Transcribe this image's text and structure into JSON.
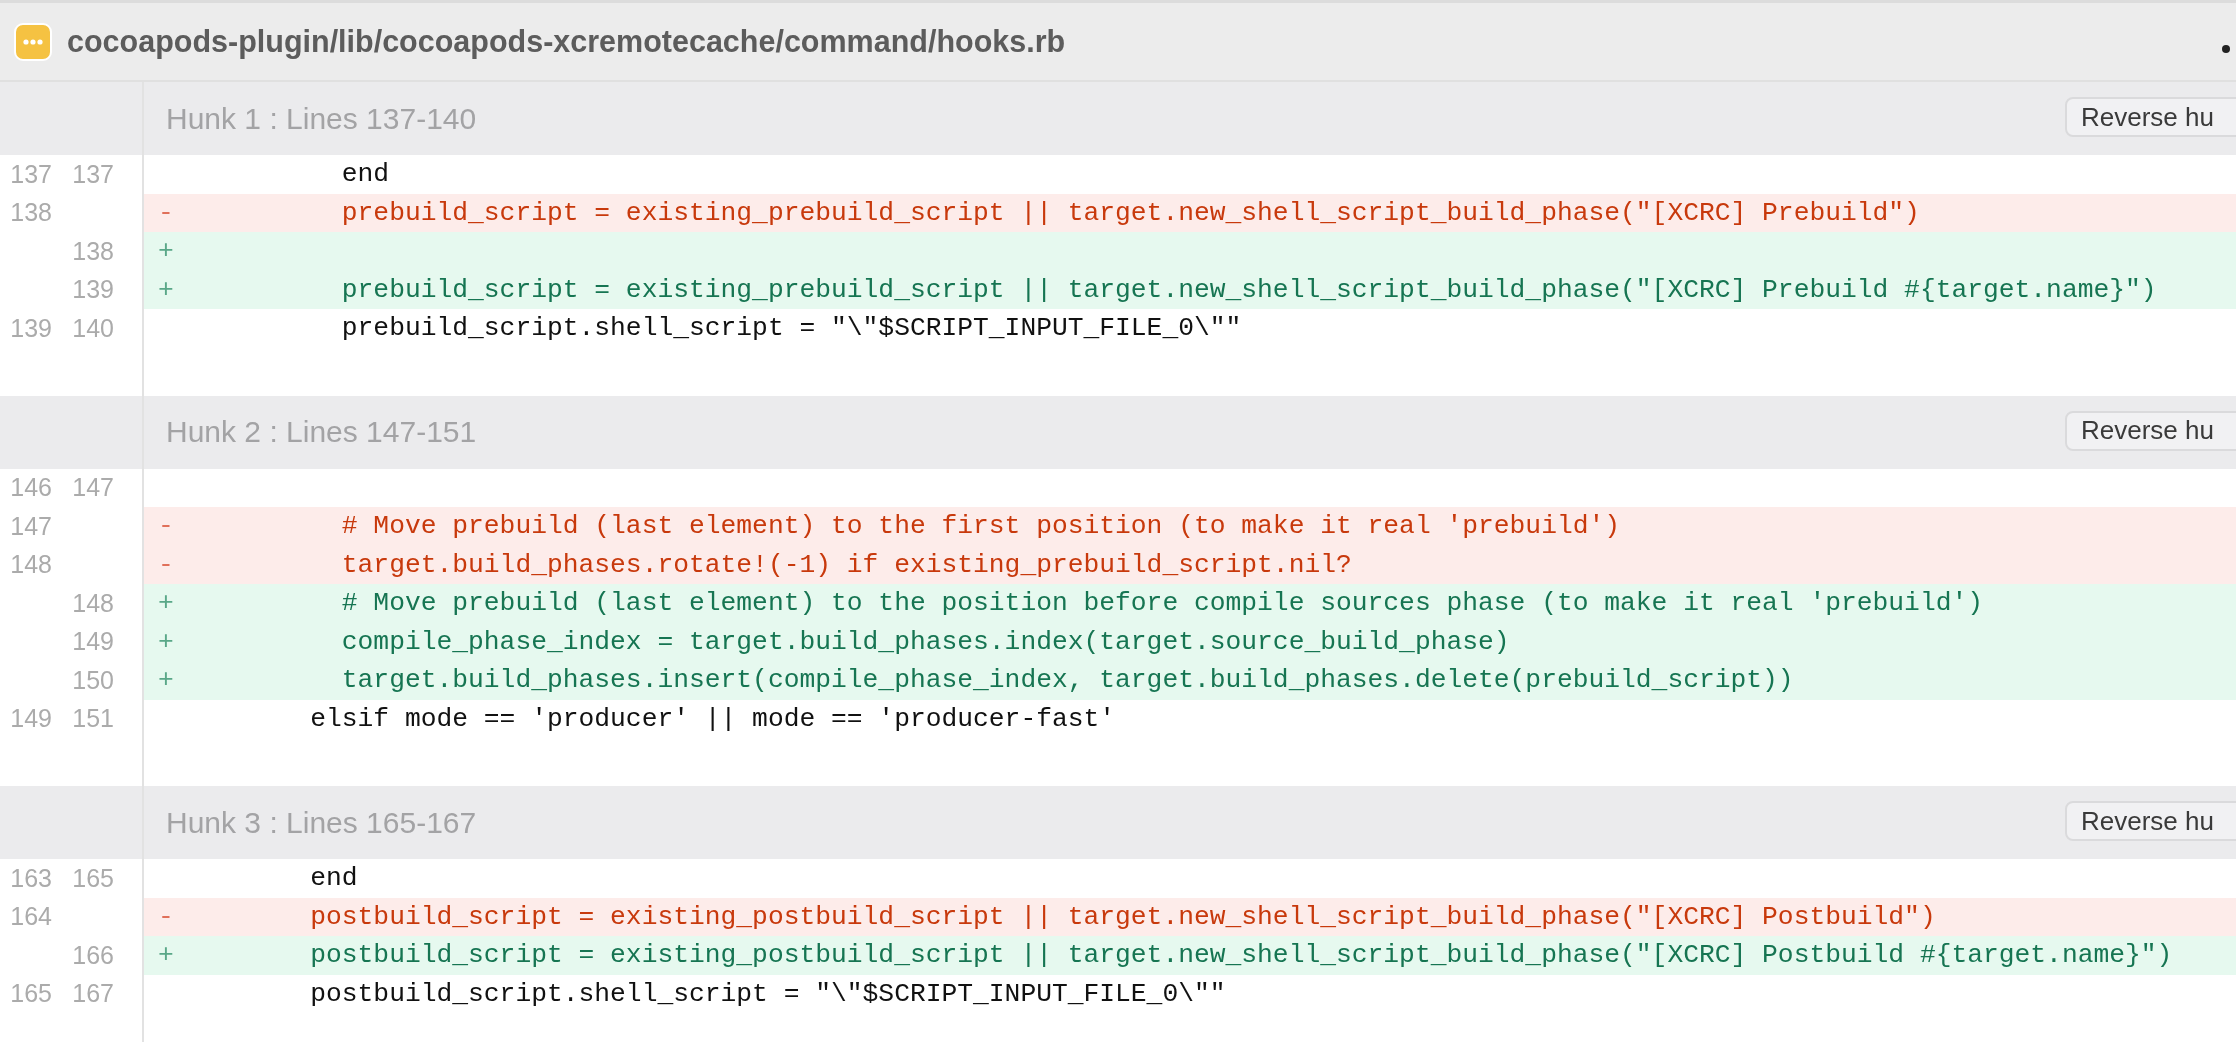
{
  "file_header": {
    "path": "cocoapods-plugin/lib/cocoapods-xcremotecache/command/hooks.rb"
  },
  "hunks": [
    {
      "title": "Hunk 1 : Lines 137-140",
      "button": "Reverse hu",
      "lines": [
        {
          "kind": "context",
          "old": "137",
          "new": "137",
          "text": "          end"
        },
        {
          "kind": "removed",
          "old": "138",
          "sign": "-",
          "text": "          prebuild_script = existing_prebuild_script || target.new_shell_script_build_phase(\"[XCRC] Prebuild\")"
        },
        {
          "kind": "added",
          "new": "138",
          "sign": "+"
        },
        {
          "kind": "added",
          "new": "139",
          "sign": "+",
          "text": "          prebuild_script = existing_prebuild_script || target.new_shell_script_build_phase(\"[XCRC] Prebuild #{target.name}\")"
        },
        {
          "kind": "context",
          "old": "139",
          "new": "140",
          "text": "          prebuild_script.shell_script = \"\\\"$SCRIPT_INPUT_FILE_0\\\"\""
        }
      ]
    },
    {
      "title": "Hunk 2 : Lines 147-151",
      "button": "Reverse hu",
      "lines": [
        {
          "kind": "context",
          "old": "146",
          "new": "147"
        },
        {
          "kind": "removed",
          "old": "147",
          "sign": "-",
          "text": "          # Move prebuild (last element) to the first position (to make it real 'prebuild')"
        },
        {
          "kind": "removed",
          "old": "148",
          "sign": "-",
          "text": "          target.build_phases.rotate!(-1) if existing_prebuild_script.nil?"
        },
        {
          "kind": "added",
          "new": "148",
          "sign": "+",
          "text": "          # Move prebuild (last element) to the position before compile sources phase (to make it real 'prebuild')"
        },
        {
          "kind": "added",
          "new": "149",
          "sign": "+",
          "text": "          compile_phase_index = target.build_phases.index(target.source_build_phase)"
        },
        {
          "kind": "added",
          "new": "150",
          "sign": "+",
          "text": "          target.build_phases.insert(compile_phase_index, target.build_phases.delete(prebuild_script))"
        },
        {
          "kind": "context",
          "old": "149",
          "new": "151",
          "text": "        elsif mode == 'producer' || mode == 'producer-fast'"
        }
      ]
    },
    {
      "title": "Hunk 3 : Lines 165-167",
      "button": "Reverse hu",
      "lines": [
        {
          "kind": "context",
          "old": "163",
          "new": "165",
          "text": "        end"
        },
        {
          "kind": "removed",
          "old": "164",
          "sign": "-",
          "text": "        postbuild_script = existing_postbuild_script || target.new_shell_script_build_phase(\"[XCRC] Postbuild\")"
        },
        {
          "kind": "added",
          "new": "166",
          "sign": "+",
          "text": "        postbuild_script = existing_postbuild_script || target.new_shell_script_build_phase(\"[XCRC] Postbuild #{target.name}\")"
        },
        {
          "kind": "context",
          "old": "165",
          "new": "167",
          "text": "        postbuild_script.shell_script = \"\\\"$SCRIPT_INPUT_FILE_0\\\"\""
        }
      ]
    }
  ]
}
